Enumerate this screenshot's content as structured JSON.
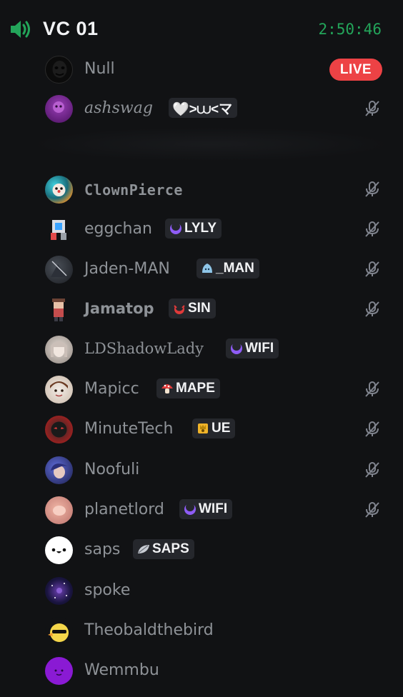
{
  "channel": {
    "name": "VC 01",
    "timer": "2:50:46"
  },
  "colors": {
    "background": "#111214",
    "accent_green": "#23a55a",
    "live_red": "#ed4245",
    "username_gray": "#8e9297"
  },
  "users": [
    {
      "name": "Null",
      "live_badge": "LIVE",
      "avatar_icon": "dark-mask-avatar"
    },
    {
      "name": "ashswag",
      "tag": "🤍>⩊<マ",
      "muted": true,
      "avatar_icon": "purple-character-avatar"
    },
    {
      "name": "ClownPierce",
      "muted": true,
      "avatar_icon": "clown-avatar"
    },
    {
      "name": "eggchan",
      "tag": "LYLY",
      "tag_icon": "purple-moon-icon",
      "muted": true,
      "avatar_icon": "cube-avatar"
    },
    {
      "name": "Jaden-MAN",
      "tag": "_MAN",
      "tag_icon": "blue-slime-icon",
      "muted": true,
      "avatar_icon": "dark-figure-avatar"
    },
    {
      "name": "Jamatop",
      "tag": "SIN",
      "tag_icon": "red-horns-icon",
      "muted": true,
      "avatar_icon": "pixel-character-avatar"
    },
    {
      "name": "LDShadowLady",
      "tag": "WIFI",
      "tag_icon": "purple-moon-icon",
      "muted": false,
      "avatar_icon": "pale-hair-avatar"
    },
    {
      "name": "Mapicc",
      "tag": "MAPE",
      "tag_icon": "mushroom-icon",
      "muted": true,
      "avatar_icon": "brown-hair-avatar"
    },
    {
      "name": "MinuteTech",
      "tag": "UE",
      "tag_icon": "gold-badge-icon",
      "muted": true,
      "avatar_icon": "red-mask-avatar"
    },
    {
      "name": "Noofuli",
      "muted": true,
      "avatar_icon": "blue-hair-avatar"
    },
    {
      "name": "planetlord",
      "tag": "WIFI",
      "tag_icon": "purple-moon-icon",
      "muted": true,
      "avatar_icon": "peach-avatar"
    },
    {
      "name": "saps",
      "tag": "SAPS",
      "tag_icon": "leaf-icon",
      "muted": false,
      "avatar_icon": "smiley-face-avatar"
    },
    {
      "name": "spoke",
      "muted": false,
      "avatar_icon": "galaxy-avatar"
    },
    {
      "name": "Theobaldthebird",
      "muted": false,
      "avatar_icon": "yellow-bird-avatar"
    },
    {
      "name": "Wemmbu",
      "muted": false,
      "avatar_icon": "purple-blob-avatar"
    }
  ]
}
